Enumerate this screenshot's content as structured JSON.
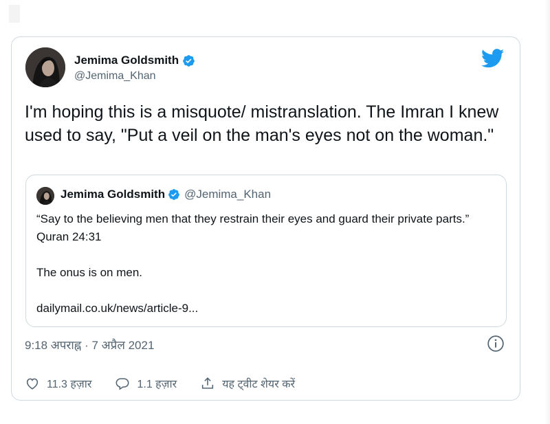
{
  "tweet": {
    "author": {
      "name": "Jemima Goldsmith",
      "handle": "@Jemima_Khan"
    },
    "text": "I'm hoping this is a misquote/ mistranslation. The Imran I knew used to say,  \"Put a veil on the man's eyes not on the woman.\"",
    "quoted": {
      "name": "Jemima Goldsmith",
      "handle": "@Jemima_Khan",
      "text_line1": "“Say to the believing men that they restrain their eyes and guard their private parts.” Quran 24:31",
      "text_line2": "The onus is on men.",
      "link": "dailymail.co.uk/news/article-9..."
    },
    "timestamp": "9:18 अपराह्न · 7 अप्रैल 2021",
    "actions": {
      "likes": "11.3 हज़ार",
      "replies": "1.1 हज़ार",
      "share_label": "यह ट्वीट शेयर करें"
    }
  },
  "icons": {
    "logo": "twitter-bird-icon",
    "verified": "verified-badge-icon",
    "info": "info-icon",
    "like": "heart-icon",
    "reply": "comment-icon",
    "share": "share-icon"
  },
  "colors": {
    "twitter_blue": "#1d9bf0",
    "text_primary": "#0f1419",
    "text_secondary": "#536471",
    "border": "#cfd9de"
  }
}
